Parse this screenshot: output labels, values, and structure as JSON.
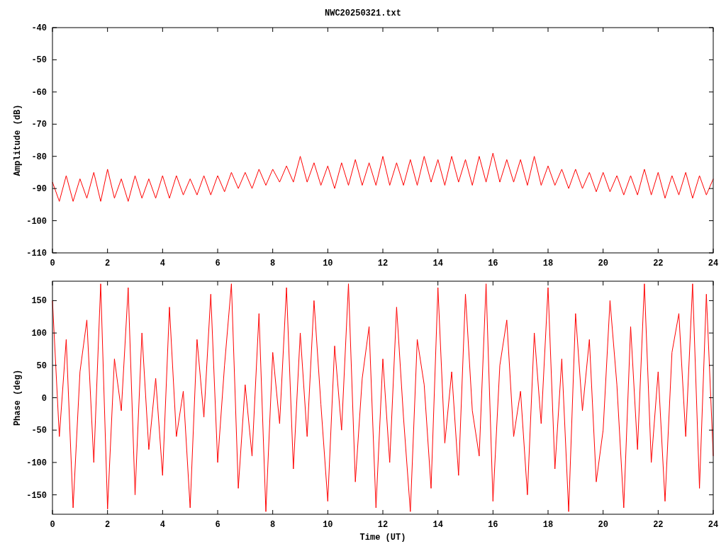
{
  "title": "NWC20250321.txt",
  "charts": [
    {
      "chart_data": {
        "type": "line",
        "ylabel": "Amplitude (dB)",
        "xlim": [
          0,
          24
        ],
        "ylim": [
          -110,
          -40
        ],
        "xticks": [
          0,
          2,
          4,
          6,
          8,
          10,
          12,
          14,
          16,
          18,
          20,
          22,
          24
        ],
        "yticks": [
          -110,
          -100,
          -90,
          -80,
          -70,
          -60,
          -50,
          -40
        ],
        "x": [
          0,
          0.25,
          0.5,
          0.75,
          1,
          1.25,
          1.5,
          1.75,
          2,
          2.25,
          2.5,
          2.75,
          3,
          3.25,
          3.5,
          3.75,
          4,
          4.25,
          4.5,
          4.75,
          5,
          5.25,
          5.5,
          5.75,
          6,
          6.25,
          6.5,
          6.75,
          7,
          7.25,
          7.5,
          7.75,
          8,
          8.25,
          8.5,
          8.75,
          9,
          9.25,
          9.5,
          9.75,
          10,
          10.25,
          10.5,
          10.75,
          11,
          11.25,
          11.5,
          11.75,
          12,
          12.25,
          12.5,
          12.75,
          13,
          13.25,
          13.5,
          13.75,
          14,
          14.25,
          14.5,
          14.75,
          15,
          15.25,
          15.5,
          15.75,
          16,
          16.25,
          16.5,
          16.75,
          17,
          17.25,
          17.5,
          17.75,
          18,
          18.25,
          18.5,
          18.75,
          19,
          19.25,
          19.5,
          19.75,
          20,
          20.25,
          20.5,
          20.75,
          21,
          21.25,
          21.5,
          21.75,
          22,
          22.25,
          22.5,
          22.75,
          23,
          23.25,
          23.5,
          23.75,
          24
        ],
        "series": [
          {
            "color": "#ff0000",
            "values": [
              -88,
              -94,
              -86,
              -94,
              -87,
              -93,
              -85,
              -94,
              -84,
              -93,
              -87,
              -94,
              -86,
              -93,
              -87,
              -93,
              -86,
              -93,
              -86,
              -92,
              -87,
              -92,
              -86,
              -92,
              -86,
              -91,
              -85,
              -90,
              -85,
              -90,
              -84,
              -89,
              -84,
              -88,
              -83,
              -88,
              -80,
              -88,
              -82,
              -89,
              -83,
              -90,
              -82,
              -89,
              -81,
              -89,
              -82,
              -89,
              -80,
              -89,
              -82,
              -89,
              -81,
              -89,
              -80,
              -88,
              -81,
              -89,
              -80,
              -88,
              -81,
              -89,
              -80,
              -88,
              -79,
              -88,
              -81,
              -88,
              -81,
              -89,
              -80,
              -89,
              -83,
              -89,
              -84,
              -90,
              -84,
              -90,
              -85,
              -91,
              -85,
              -91,
              -86,
              -92,
              -86,
              -92,
              -84,
              -92,
              -85,
              -93,
              -86,
              -92,
              -85,
              -93,
              -86,
              -92,
              -87
            ]
          }
        ]
      }
    },
    {
      "chart_data": {
        "type": "line",
        "xlabel": "Time (UT)",
        "ylabel": "Phase (deg)",
        "xlim": [
          0,
          24
        ],
        "ylim": [
          -180,
          180
        ],
        "xticks": [
          0,
          2,
          4,
          6,
          8,
          10,
          12,
          14,
          16,
          18,
          20,
          22,
          24
        ],
        "yticks": [
          -150,
          -100,
          -50,
          0,
          50,
          100,
          150
        ],
        "x": [
          0,
          0.25,
          0.5,
          0.75,
          1,
          1.25,
          1.5,
          1.75,
          2,
          2.25,
          2.5,
          2.75,
          3,
          3.25,
          3.5,
          3.75,
          4,
          4.25,
          4.5,
          4.75,
          5,
          5.25,
          5.5,
          5.75,
          6,
          6.25,
          6.5,
          6.75,
          7,
          7.25,
          7.5,
          7.75,
          8,
          8.25,
          8.5,
          8.75,
          9,
          9.25,
          9.5,
          9.75,
          10,
          10.25,
          10.5,
          10.75,
          11,
          11.25,
          11.5,
          11.75,
          12,
          12.25,
          12.5,
          12.75,
          13,
          13.25,
          13.5,
          13.75,
          14,
          14.25,
          14.5,
          14.75,
          15,
          15.25,
          15.5,
          15.75,
          16,
          16.25,
          16.5,
          16.75,
          17,
          17.25,
          17.5,
          17.75,
          18,
          18.25,
          18.5,
          18.75,
          19,
          19.25,
          19.5,
          19.75,
          20,
          20.25,
          20.5,
          20.75,
          21,
          21.25,
          21.5,
          21.75,
          22,
          22.25,
          22.5,
          22.75,
          23,
          23.25,
          23.5,
          23.75,
          24
        ],
        "series": [
          {
            "color": "#ff0000",
            "values": [
              150,
              -60,
              90,
              -170,
              40,
              120,
              -100,
              176,
              -172,
              60,
              -20,
              170,
              -150,
              100,
              -80,
              30,
              -120,
              140,
              -60,
              10,
              -170,
              90,
              -30,
              160,
              -100,
              50,
              176,
              -140,
              20,
              -90,
              130,
              -176,
              70,
              -40,
              170,
              -110,
              100,
              -60,
              150,
              -10,
              -160,
              80,
              -50,
              176,
              -130,
              30,
              110,
              -170,
              60,
              -100,
              140,
              -30,
              -176,
              90,
              20,
              -140,
              170,
              -70,
              40,
              -120,
              160,
              -20,
              -90,
              176,
              -160,
              50,
              120,
              -60,
              10,
              -150,
              100,
              -40,
              170,
              -110,
              60,
              -176,
              130,
              -20,
              90,
              -130,
              -50,
              150,
              20,
              -170,
              110,
              -80,
              176,
              -100,
              40,
              -160,
              70,
              130,
              -60,
              176,
              -140,
              160,
              -90
            ]
          }
        ]
      }
    }
  ]
}
